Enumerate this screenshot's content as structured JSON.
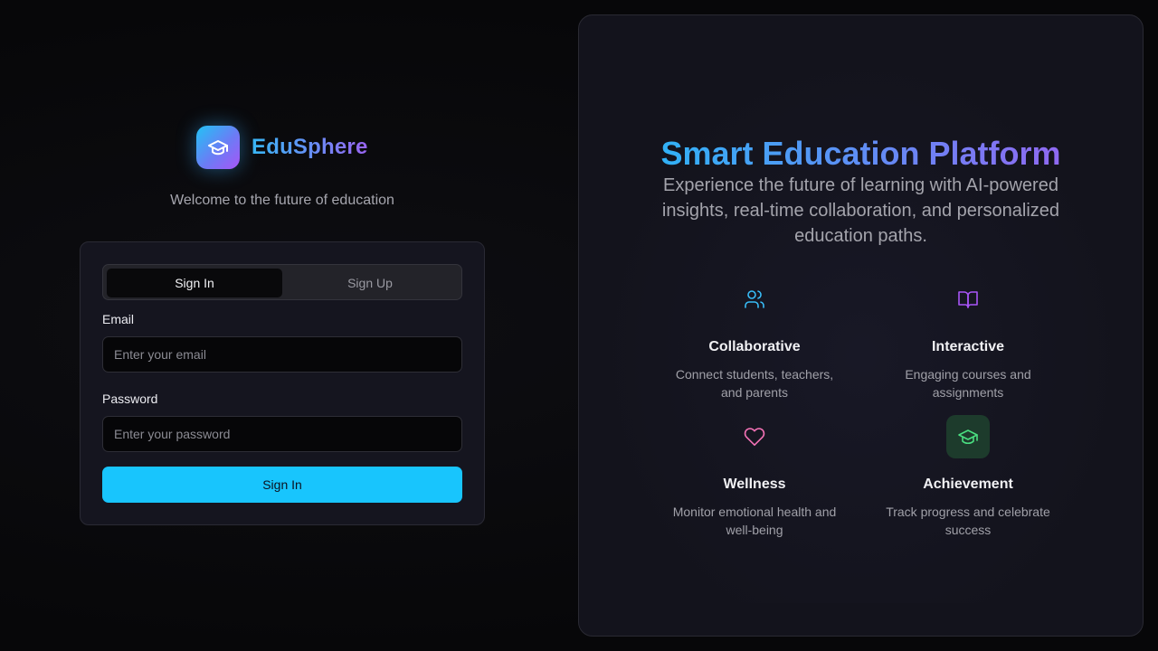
{
  "brand": {
    "name": "EduSphere",
    "logo_icon": "graduation-cap-icon",
    "tagline": "Welcome to the future of education"
  },
  "auth": {
    "tabs": [
      {
        "label": "Sign In",
        "active": true
      },
      {
        "label": "Sign Up",
        "active": false
      }
    ],
    "email": {
      "label": "Email",
      "placeholder": "Enter your email",
      "value": ""
    },
    "password": {
      "label": "Password",
      "placeholder": "Enter your password",
      "value": ""
    },
    "submit_label": "Sign In"
  },
  "showcase": {
    "title": "Smart Education Platform",
    "description": "Experience the future of learning with AI-powered insights, real-time collaboration, and personalized education paths.",
    "features": [
      {
        "icon": "users-icon",
        "title": "Collaborative",
        "description": "Connect students, teachers, and parents",
        "color": "#38bdf8"
      },
      {
        "icon": "book-open-icon",
        "title": "Interactive",
        "description": "Engaging courses and assignments",
        "color": "#a855f7"
      },
      {
        "icon": "heart-icon",
        "title": "Wellness",
        "description": "Monitor emotional health and well-being",
        "color": "#f472b6"
      },
      {
        "icon": "graduation-cap-icon",
        "title": "Achievement",
        "description": "Track progress and celebrate success",
        "color": "#4ade80"
      }
    ]
  },
  "colors": {
    "accent": "#18c5fd",
    "background": "#08080a",
    "card": "#15151f"
  }
}
